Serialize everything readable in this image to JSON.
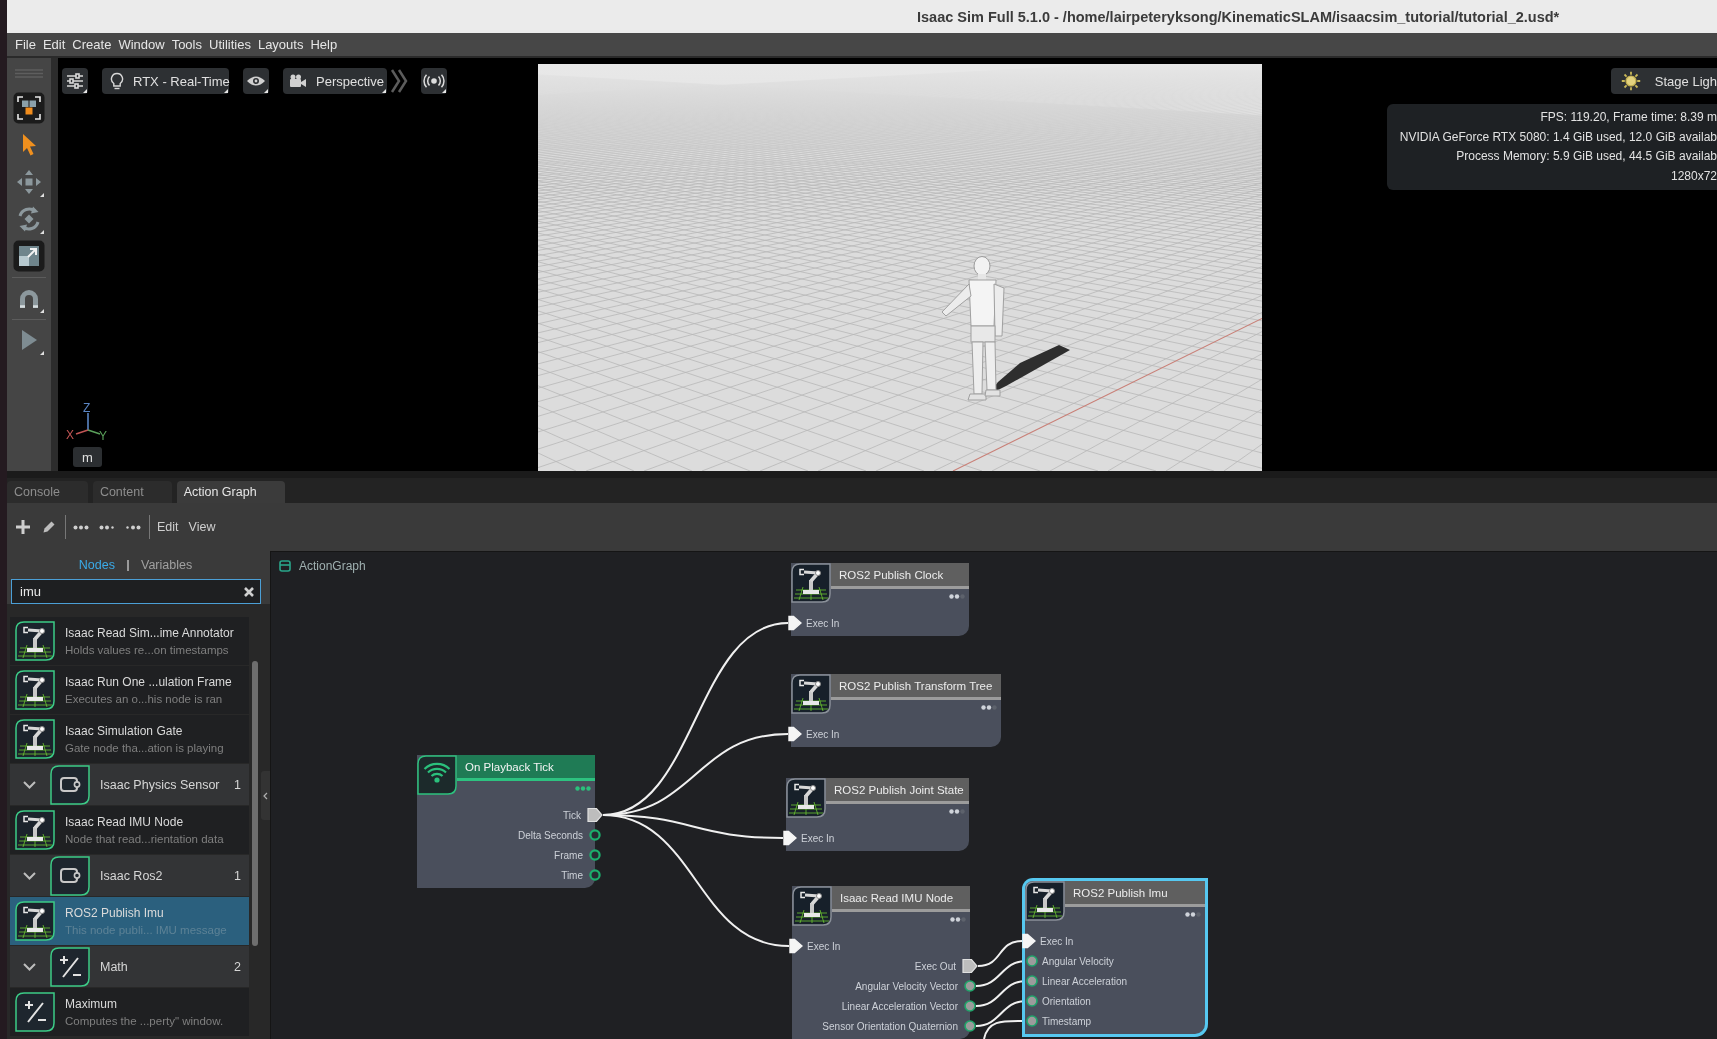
{
  "window": {
    "title": "Isaac Sim Full 5.1.0 - /home/lairpeteryksong/KinematicSLAM/isaacsim_tutorial/tutorial_2.usd*"
  },
  "menu": [
    "File",
    "Edit",
    "Create",
    "Window",
    "Tools",
    "Utilities",
    "Layouts",
    "Help"
  ],
  "tool_strip": [
    {
      "kind": "selectmode",
      "on": true
    },
    {
      "kind": "pointer",
      "on": false
    },
    {
      "kind": "move",
      "on": false
    },
    {
      "kind": "rotate",
      "on": false
    },
    {
      "kind": "scale",
      "on": true
    },
    {
      "kind": "snap",
      "on": false
    },
    {
      "kind": "play",
      "on": false
    }
  ],
  "viewport": {
    "render_mode": "RTX - Real-Time",
    "camera": "Perspective",
    "lights": "Stage Ligh",
    "stats": [
      "FPS: 119.20, Frame time: 8.39 m",
      "NVIDIA GeForce RTX 5080: 1.4 GiB used, 12.0 GiB availab",
      "Process Memory: 5.9 GiB used, 44.5 GiB availab",
      "1280x72"
    ],
    "axes": {
      "z": "Z",
      "x": "X",
      "y": "Y"
    },
    "units": "m"
  },
  "panel_tabs": [
    {
      "label": "Console",
      "selected": false
    },
    {
      "label": "Content",
      "selected": false
    },
    {
      "label": "Action Graph",
      "selected": true
    }
  ],
  "graph_toolbar": {
    "menus": [
      "Edit",
      "View"
    ]
  },
  "library": {
    "tabs": [
      {
        "label": "Nodes",
        "selected": true
      },
      {
        "label": "Variables",
        "selected": false
      }
    ],
    "search": {
      "value": "imu"
    },
    "groups": [
      {
        "kind": "isaac",
        "items": [
          {
            "title": "Isaac Read Sim...ime Annotator",
            "description": "Holds values re...on timestamps",
            "selected": false
          },
          {
            "title": "Isaac Run One ...ulation Frame",
            "description": "Executes an o...his node is ran",
            "selected": false
          },
          {
            "title": "Isaac Simulation Gate",
            "description": "Gate node tha...ation is playing",
            "selected": false
          }
        ]
      },
      {
        "kind": "isaac",
        "title": "Isaac Physics Sensor",
        "count": "1",
        "expanded": true,
        "items": [
          {
            "title": "Isaac Read IMU Node",
            "description": "Node that read...rientation data",
            "selected": false
          }
        ]
      },
      {
        "kind": "isaac",
        "title": "Isaac Ros2",
        "count": "1",
        "expanded": true,
        "items": [
          {
            "title": "ROS2 Publish Imu",
            "description": "This node publi... IMU message",
            "selected": true
          }
        ]
      },
      {
        "kind": "math",
        "title": "Math",
        "count": "2",
        "expanded": true,
        "items": [
          {
            "title": "Maximum",
            "description": "Computes the ...perty\" window.",
            "selected": false
          }
        ]
      }
    ]
  },
  "graph": {
    "breadcrumb": "ActionGraph",
    "nodes": [
      {
        "kind": "event",
        "title": "On Playback Tick",
        "selected": false,
        "outputs": [
          {
            "label": "Tick",
            "kind": "exec",
            "connected": true
          },
          {
            "label": "Delta Seconds",
            "kind": "data",
            "connected": false
          },
          {
            "label": "Frame",
            "kind": "data",
            "connected": false
          },
          {
            "label": "Time",
            "kind": "data",
            "connected": false
          }
        ]
      },
      {
        "kind": "action",
        "title": "ROS2 Publish Clock",
        "selected": false,
        "inputs": [
          {
            "label": "Exec In",
            "kind": "exec",
            "connected": true
          }
        ]
      },
      {
        "kind": "action",
        "title": "ROS2 Publish Transform Tree",
        "selected": false,
        "inputs": [
          {
            "label": "Exec In",
            "kind": "exec",
            "connected": true
          }
        ]
      },
      {
        "kind": "action",
        "title": "ROS2 Publish Joint State",
        "selected": false,
        "inputs": [
          {
            "label": "Exec In",
            "kind": "exec",
            "connected": true
          }
        ]
      },
      {
        "kind": "action",
        "title": "Isaac Read IMU Node",
        "selected": false,
        "inputs": [
          {
            "label": "Exec In",
            "kind": "exec",
            "connected": true
          }
        ],
        "outputs": [
          {
            "label": "Exec Out",
            "kind": "exec",
            "connected": true
          },
          {
            "label": "Angular Velocity Vector",
            "kind": "data",
            "connected": true
          },
          {
            "label": "Linear Acceleration Vector",
            "kind": "data",
            "connected": true
          },
          {
            "label": "Sensor Orientation Quaternion",
            "kind": "data",
            "connected": true
          }
        ]
      },
      {
        "kind": "action",
        "title": "ROS2 Publish Imu",
        "selected": true,
        "inputs": [
          {
            "label": "Exec In",
            "kind": "exec",
            "connected": true
          },
          {
            "label": "Angular Velocity",
            "kind": "data",
            "connected": true
          },
          {
            "label": "Linear Acceleration",
            "kind": "data",
            "connected": true
          },
          {
            "label": "Orientation",
            "kind": "data",
            "connected": true
          },
          {
            "label": "Timestamp",
            "kind": "data",
            "connected": true
          }
        ]
      }
    ]
  }
}
